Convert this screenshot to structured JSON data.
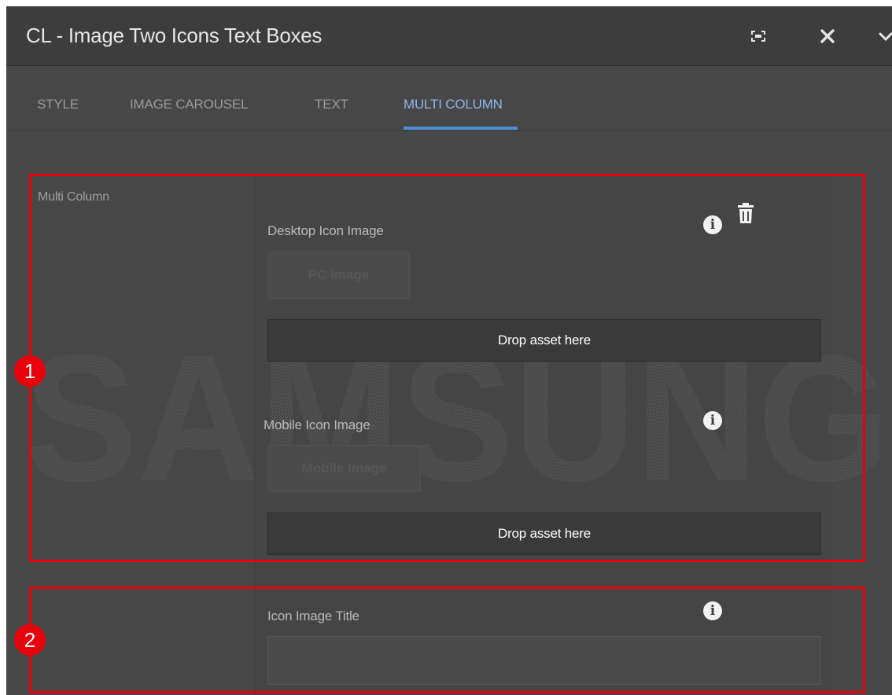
{
  "dialog": {
    "title": "CL - Image Two Icons Text Boxes",
    "icons": [
      "fullscreen-icon",
      "close-icon",
      "chevron-down-icon"
    ]
  },
  "tabs": [
    {
      "label": "STYLE",
      "active": false
    },
    {
      "label": "IMAGE CAROUSEL",
      "active": false
    },
    {
      "label": "TEXT",
      "active": false
    },
    {
      "label": "MULTI COLUMN",
      "active": true
    }
  ],
  "section": {
    "label": "Multi Column"
  },
  "fields": {
    "desktop_icon": {
      "label": "Desktop Icon Image",
      "button": "PC Image",
      "dropzone": "Drop asset here"
    },
    "mobile_icon": {
      "label": "Mobile Icon Image",
      "button": "Mobile Image",
      "dropzone": "Drop asset here"
    },
    "icon_title": {
      "label": "Icon Image Title",
      "value": ""
    }
  },
  "watermark": {
    "text": "SAMSUNG"
  },
  "annotations": [
    {
      "number": "1"
    },
    {
      "number": "2"
    }
  ],
  "colors": {
    "dialog_bg": "#4a4a4a",
    "titlebar_bg": "#3d3d3d",
    "active_tab": "#8cb8e8",
    "tab_underline": "#4a8fd8",
    "annotation_red": "#e8000b"
  }
}
